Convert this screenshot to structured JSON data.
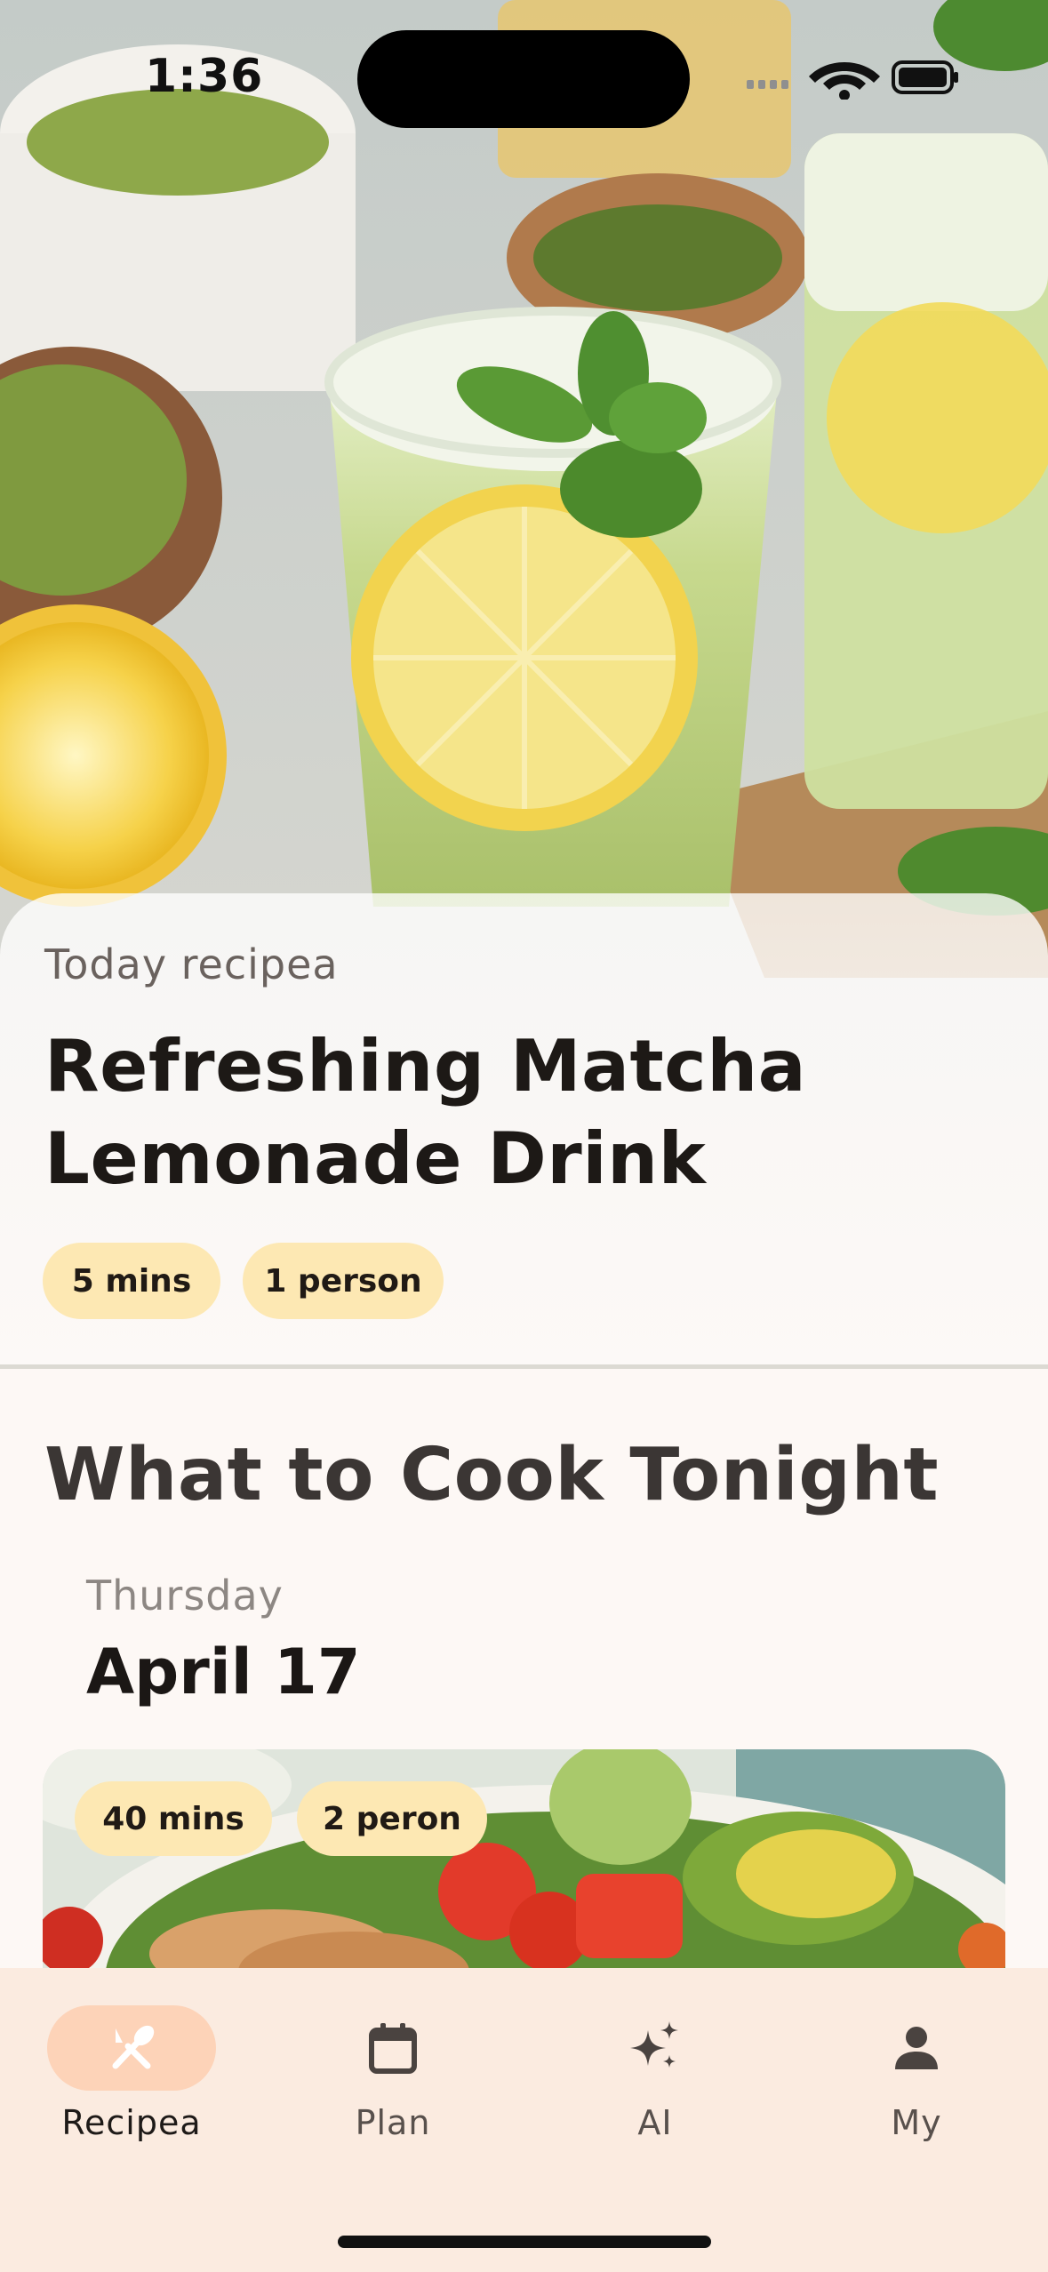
{
  "status_bar": {
    "time": "1:36"
  },
  "hero": {
    "image": "matcha-lemonade-photo",
    "eyebrow": "Today recipea",
    "title": "Refreshing Matcha Lemonade Drink",
    "chips": [
      "5 mins",
      "1 person"
    ]
  },
  "tonight": {
    "title": "What to Cook Tonight",
    "day": "Thursday",
    "date": "April 17",
    "card": {
      "image": "grilled-chicken-salad-photo",
      "chips": [
        "40 mins",
        "2 peron"
      ]
    }
  },
  "tabbar": {
    "items": [
      {
        "label": "Recipea",
        "icon": "utensils-icon",
        "active": true
      },
      {
        "label": "Plan",
        "icon": "calendar-icon",
        "active": false
      },
      {
        "label": "AI",
        "icon": "sparkles-icon",
        "active": false
      },
      {
        "label": "My",
        "icon": "person-icon",
        "active": false
      }
    ]
  },
  "colors": {
    "chip": "#fde8b3",
    "active_tab": "#fdd3b8",
    "tabbar_bg": "#fbebe0",
    "page_bg": "#fdf8f5"
  }
}
